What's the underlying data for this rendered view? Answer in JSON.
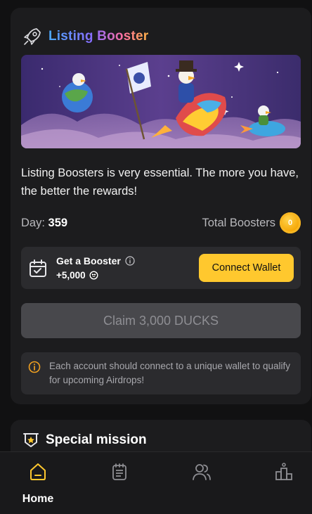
{
  "listing": {
    "title": "Listing Booster",
    "description": "Listing Boosters is very essential. The more you have, the better the rewards!",
    "day_label": "Day:",
    "day_value": "359",
    "total_boosters_label": "Total Boosters",
    "total_boosters_value": "0"
  },
  "booster": {
    "title": "Get a Booster",
    "reward": "+5,000",
    "connect_label": "Connect Wallet"
  },
  "claim": {
    "label": "Claim 3,000 DUCKS"
  },
  "notice": {
    "text": "Each account should connect to a unique wallet to qualify for upcoming Airdrops!"
  },
  "mission": {
    "title": "Special mission"
  },
  "nav": {
    "items": [
      {
        "label": "Home",
        "icon": "home-icon",
        "active": true
      },
      {
        "label": "",
        "icon": "tasks-icon",
        "active": false
      },
      {
        "label": "",
        "icon": "friends-icon",
        "active": false
      },
      {
        "label": "",
        "icon": "leaderboard-icon",
        "active": false
      }
    ]
  },
  "colors": {
    "accent": "#ffc82e",
    "card": "#1c1c1e",
    "background": "#111112",
    "disabled": "#48484c"
  }
}
